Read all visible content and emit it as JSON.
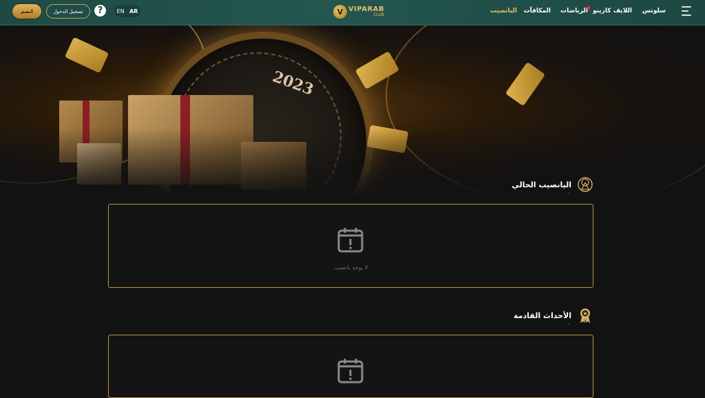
{
  "header": {
    "join_label": "انضم",
    "login_label": "تسجيل الدخول",
    "help_symbol": "?",
    "lang_en": "EN",
    "lang_ar": "AR",
    "logo_main": "VIPARAB",
    "logo_sub": "CLUB",
    "nav": [
      {
        "label": "سلوتس",
        "active": false
      },
      {
        "label": "اللايف كازينو",
        "active": false
      },
      {
        "label": "الرياضات",
        "active": false,
        "badge": true
      },
      {
        "label": "المكافآت",
        "active": false
      },
      {
        "label": "اليانصيب",
        "active": true
      }
    ]
  },
  "banner": {
    "year": "2023"
  },
  "sections": [
    {
      "title": "اليانصيب الحالي",
      "subtitle": "-",
      "empty_text": "لا يوجد يانصيب"
    },
    {
      "title": "الأحداث القادمة",
      "subtitle": "-",
      "empty_text": ""
    }
  ],
  "colors": {
    "header_bg": "#23564f",
    "accent_gold": "#e6bf6a",
    "box_border": "#b89650",
    "page_bg": "#121212",
    "badge_red": "#ff2a3a"
  }
}
